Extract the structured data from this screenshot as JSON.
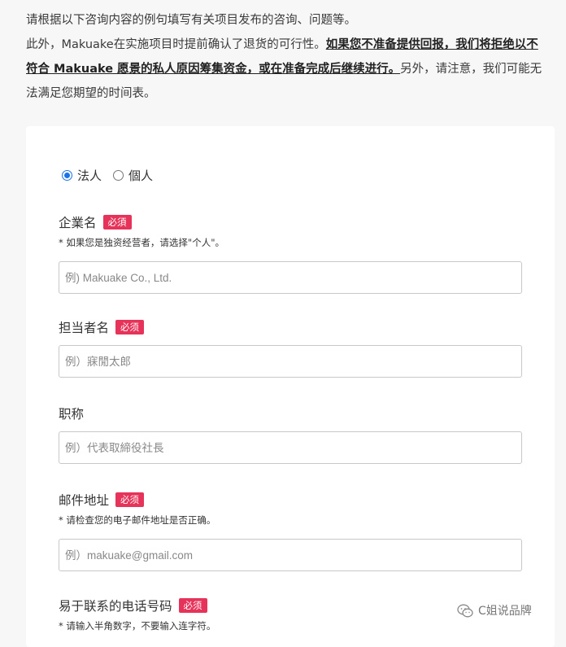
{
  "intro": {
    "line1": "请根据以下咨询内容的例句填写有关项目发布的咨询、问题等。",
    "line2_prefix": "此外，Makuake在实施项目时提前确认了退货的可行性。",
    "line2_strong": "如果您不准备提供回报，我们将拒绝以不符合 Makuake 愿景的私人原因筹集资金，或在准备完成后继续进行。",
    "line2_suffix": "另外，请注意，我们可能无法满足您期望的时间表。"
  },
  "radio": {
    "options": [
      {
        "label": "法人",
        "checked": true
      },
      {
        "label": "個人",
        "checked": false
      }
    ]
  },
  "fields": {
    "company": {
      "label": "企業名",
      "badge": "必須",
      "hint": "* 如果您是独资经营者，请选择\"个人\"。",
      "placeholder": "例) Makuake Co., Ltd."
    },
    "contact": {
      "label": "担当者名",
      "badge": "必须",
      "placeholder": "例）寐閒太郎"
    },
    "title": {
      "label": "职称",
      "placeholder": "例）代表取締役社長"
    },
    "email": {
      "label": "邮件地址",
      "badge": "必须",
      "hint": "* 请检查您的电子邮件地址是否正确。",
      "placeholder": "例）makuake@gmail.com"
    },
    "phone": {
      "label": "易于联系的电话号码",
      "badge": "必须",
      "hint": "* 请输入半角数字，不要输入连字符。"
    }
  },
  "watermark": {
    "text": "C姐说品牌",
    "icon": "wechat-icon"
  },
  "colors": {
    "badge": "#e6335a",
    "radio_accent": "#1a73e8",
    "page_bg": "#f7f7f7"
  }
}
